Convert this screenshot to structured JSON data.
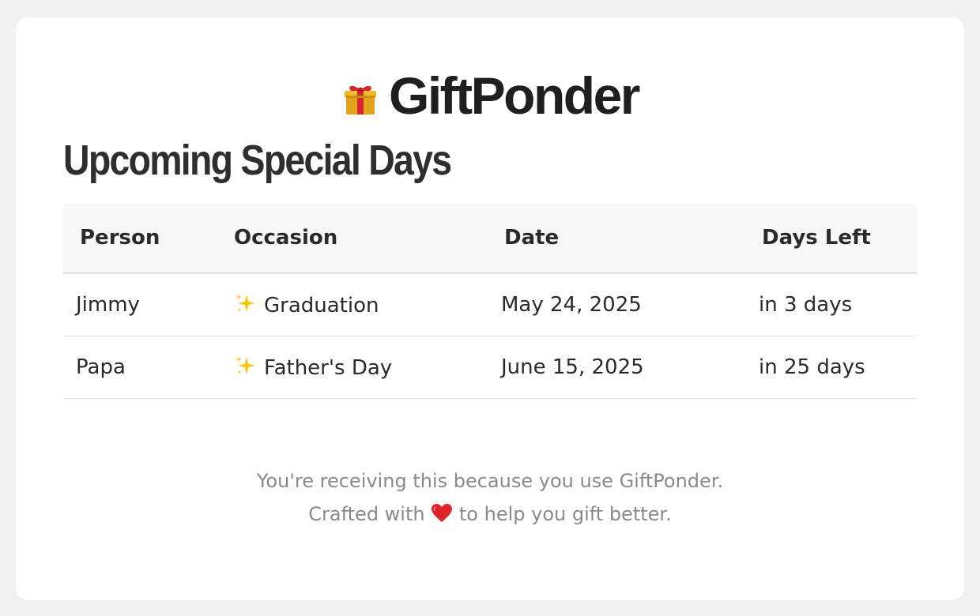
{
  "brand": {
    "name": "GiftPonder",
    "icon": "gift-icon"
  },
  "section": {
    "title": "Upcoming Special Days"
  },
  "table": {
    "headers": {
      "person": "Person",
      "occasion": "Occasion",
      "date": "Date",
      "days_left": "Days Left"
    },
    "rows": [
      {
        "person": "Jimmy",
        "occasion_icon": "sparkles-icon",
        "occasion": "Graduation",
        "date": "May 24, 2025",
        "days_left": "in 3 days"
      },
      {
        "person": "Papa",
        "occasion_icon": "sparkles-icon",
        "occasion": "Father's Day",
        "date": "June 15, 2025",
        "days_left": "in 25 days"
      }
    ]
  },
  "footer": {
    "line1": "You're receiving this because you use GiftPonder.",
    "line2_before": "Crafted with",
    "line2_icon": "heart-icon",
    "line2_after": "to help you gift better."
  },
  "colors": {
    "page_bg": "#f1f1f1",
    "card_bg": "#ffffff",
    "text": "#2b2b2b",
    "muted": "#8a8a8a",
    "header_bg": "#f7f7f7",
    "heart": "#e0242b",
    "sparkle": "#f5c518"
  }
}
